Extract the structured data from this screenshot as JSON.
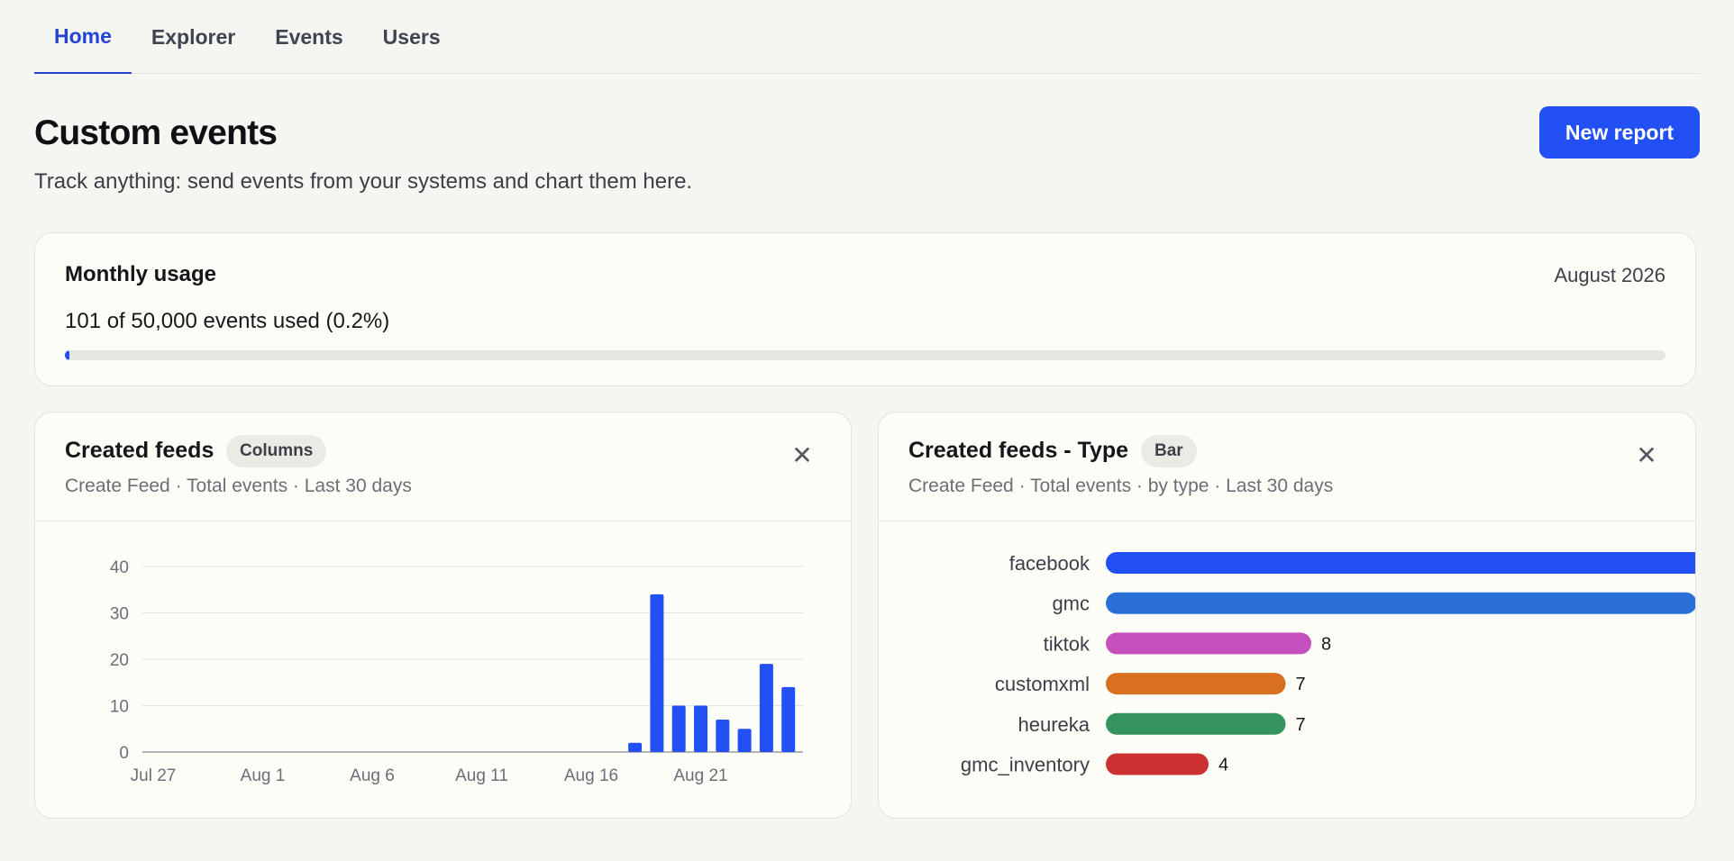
{
  "tabs": [
    {
      "label": "Home",
      "active": true
    },
    {
      "label": "Explorer",
      "active": false
    },
    {
      "label": "Events",
      "active": false
    },
    {
      "label": "Users",
      "active": false
    }
  ],
  "header": {
    "title": "Custom events",
    "subtitle": "Track anything: send events from your systems and chart them here.",
    "new_report_label": "New report"
  },
  "usage": {
    "title": "Monthly usage",
    "month": "August 2026",
    "text": "101 of 50,000 events used (0.2%)",
    "fraction": 0.002
  },
  "charts": {
    "left": {
      "title": "Created feeds",
      "badge": "Columns",
      "meta": "Create Feed · Total events · Last 30 days",
      "close_icon": "close-icon"
    },
    "right": {
      "title": "Created feeds - Type",
      "badge": "Bar",
      "meta": "Create Feed · Total events · by type · Last 30 days",
      "close_icon": "close-icon"
    }
  },
  "colors": {
    "accent": "#2350f5",
    "column": "#2350f5"
  },
  "chart_data": [
    {
      "type": "bar",
      "title": "Created feeds",
      "xlabel": "",
      "ylabel": "",
      "ylim": [
        0,
        40
      ],
      "yticks": [
        0,
        10,
        20,
        30,
        40
      ],
      "grid": true,
      "x_tick_labels": [
        "Jul 27",
        "Aug 1",
        "Aug 6",
        "Aug 11",
        "Aug 16",
        "Aug 21"
      ],
      "x_tick_index": [
        0,
        5,
        10,
        15,
        20,
        25
      ],
      "categories": [
        "Jul 27",
        "Jul 28",
        "Jul 29",
        "Jul 30",
        "Jul 31",
        "Aug 1",
        "Aug 2",
        "Aug 3",
        "Aug 4",
        "Aug 5",
        "Aug 6",
        "Aug 7",
        "Aug 8",
        "Aug 9",
        "Aug 10",
        "Aug 11",
        "Aug 12",
        "Aug 13",
        "Aug 14",
        "Aug 15",
        "Aug 16",
        "Aug 17",
        "Aug 18",
        "Aug 19",
        "Aug 20",
        "Aug 21",
        "Aug 22",
        "Aug 23",
        "Aug 24",
        "Aug 25"
      ],
      "values": [
        0,
        0,
        0,
        0,
        0,
        0,
        0,
        0,
        0,
        0,
        0,
        0,
        0,
        0,
        0,
        0,
        0,
        0,
        0,
        0,
        0,
        0,
        2,
        34,
        10,
        10,
        7,
        5,
        19,
        14
      ]
    },
    {
      "type": "bar",
      "orientation": "horizontal",
      "title": "Created feeds - Type",
      "categories": [
        "facebook",
        "gmc",
        "tiktok",
        "customxml",
        "heureka",
        "gmc_inventory"
      ],
      "values": [
        24,
        23,
        8,
        7,
        7,
        4
      ],
      "colors": [
        "#2350f5",
        "#2a6fd6",
        "#c44fbd",
        "#d9701f",
        "#359360",
        "#cc3232"
      ],
      "xlim": [
        0,
        24
      ]
    }
  ]
}
